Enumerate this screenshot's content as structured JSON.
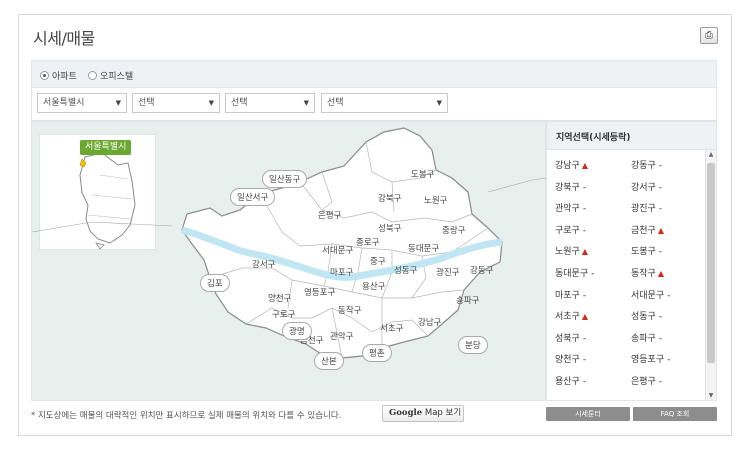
{
  "page": {
    "title": "시세/매물",
    "print_icon": "print-icon"
  },
  "filters": {
    "types": [
      {
        "label": "아파트",
        "selected": true
      },
      {
        "label": "오피스텔",
        "selected": false
      }
    ],
    "selects": [
      "서울특별시",
      "선택",
      "선택",
      "선택"
    ]
  },
  "map": {
    "inset_label": "서울특별시",
    "districts": [
      {
        "name": "도봉구"
      },
      {
        "name": "강북구"
      },
      {
        "name": "노원구"
      },
      {
        "name": "은평구"
      },
      {
        "name": "성북구"
      },
      {
        "name": "중랑구"
      },
      {
        "name": "종로구"
      },
      {
        "name": "서대문구"
      },
      {
        "name": "동대문구"
      },
      {
        "name": "중구"
      },
      {
        "name": "마포구"
      },
      {
        "name": "강서구"
      },
      {
        "name": "성동구"
      },
      {
        "name": "광진구"
      },
      {
        "name": "강동구"
      },
      {
        "name": "용산구"
      },
      {
        "name": "양천구"
      },
      {
        "name": "영등포구"
      },
      {
        "name": "구로구"
      },
      {
        "name": "동작구"
      },
      {
        "name": "송파구"
      },
      {
        "name": "강남구"
      },
      {
        "name": "서초구"
      },
      {
        "name": "관악구"
      },
      {
        "name": "금천구"
      }
    ],
    "outer": [
      {
        "name": "일산동구"
      },
      {
        "name": "일산서구"
      },
      {
        "name": "김포"
      },
      {
        "name": "광명"
      },
      {
        "name": "산본"
      },
      {
        "name": "평촌"
      },
      {
        "name": "분당"
      }
    ]
  },
  "sidebar": {
    "title": "지역선택(시세등락)",
    "items": [
      {
        "label": "강남구",
        "trend": "▲"
      },
      {
        "label": "강동구",
        "trend": "-"
      },
      {
        "label": "강북구",
        "trend": "-"
      },
      {
        "label": "강서구",
        "trend": "-"
      },
      {
        "label": "관악구",
        "trend": "-"
      },
      {
        "label": "광진구",
        "trend": "-"
      },
      {
        "label": "구로구",
        "trend": "-"
      },
      {
        "label": "금천구",
        "trend": "▲"
      },
      {
        "label": "노원구",
        "trend": "▲"
      },
      {
        "label": "도봉구",
        "trend": "-"
      },
      {
        "label": "동대문구",
        "trend": "-"
      },
      {
        "label": "동작구",
        "trend": "▲"
      },
      {
        "label": "마포구",
        "trend": "-"
      },
      {
        "label": "서대문구",
        "trend": "-"
      },
      {
        "label": "서초구",
        "trend": "▲"
      },
      {
        "label": "성동구",
        "trend": "-"
      },
      {
        "label": "성북구",
        "trend": "-"
      },
      {
        "label": "송파구",
        "trend": "-"
      },
      {
        "label": "양천구",
        "trend": "-"
      },
      {
        "label": "영등포구",
        "trend": "-"
      },
      {
        "label": "용산구",
        "trend": "-"
      },
      {
        "label": "은평구",
        "trend": "-"
      }
    ]
  },
  "footer": {
    "note": "* 지도상에는 매물의 대략적인 위치만 표시하므로 실제 매물의 위치와 다를 수 있습니다.",
    "gmap_logo": "Google",
    "gmap_label": "Map 보기",
    "btn_tool": "시세툰터",
    "btn_faq": "FAQ 조회"
  },
  "colors": {
    "map_bg": "#e7f0ed",
    "badge": "#6aa82f",
    "trend_up": "#d42a1c",
    "river": "#bfe6f2"
  }
}
